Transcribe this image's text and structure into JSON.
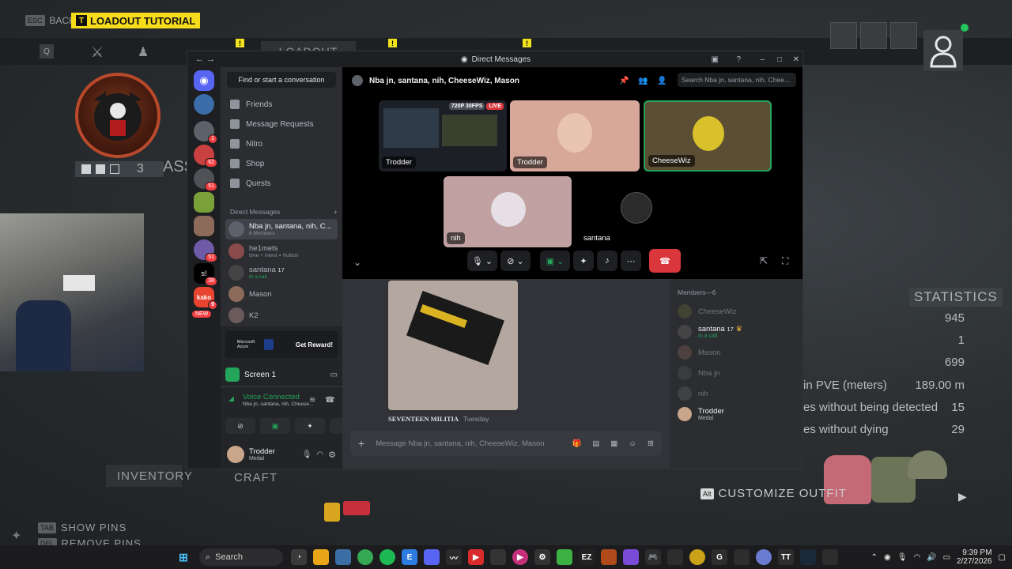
{
  "game": {
    "back_label": "BACK",
    "back_key": "ESC",
    "tutorial_label": "LOADOUT TUTORIAL",
    "tutorial_key": "T",
    "search_key": "Q",
    "active_tab": "LOADOUT",
    "emblem_label": "ASS",
    "emblem_count": "3",
    "statistics_label": "STATISTICS",
    "stats": [
      {
        "label": "",
        "value": "945"
      },
      {
        "label": "",
        "value": "1"
      },
      {
        "label": "",
        "value": "699"
      },
      {
        "label": "in PVE (meters)",
        "value": "189.00 m"
      },
      {
        "label": "es without being detected",
        "value": "15"
      },
      {
        "label": "es without dying",
        "value": "29"
      }
    ],
    "inventory_label": "INVENTORY",
    "craft_label": "CRAFT",
    "customize_label": "CUSTOMIZE OUTFIT",
    "customize_key": "Alt",
    "show_pins": "SHOW PINS",
    "remove_pins": "REMOVE PINS"
  },
  "discord": {
    "window_title": "Direct Messages",
    "find_label": "Find or start a conversation",
    "nav": [
      "Friends",
      "Message Requests",
      "Nitro",
      "Shop",
      "Quests"
    ],
    "dm_header": "Direct Messages",
    "dms": [
      {
        "name": "Nba jn, santana, nih, C...",
        "sub": "6 Members",
        "color": "#5d6169"
      },
      {
        "name": "he1mets",
        "sub": "time + intent = fruition",
        "color": "#8a4b4b"
      },
      {
        "name": "santana",
        "sub": "In a call",
        "badge": "17",
        "color": "#444"
      },
      {
        "name": "Mason",
        "sub": "",
        "color": "#8c6b5a"
      },
      {
        "name": "K2",
        "sub": "",
        "color": "#6b5a5a"
      }
    ],
    "server_badges": [
      "1",
      "62",
      "51",
      "51",
      "38",
      "9",
      "NEW"
    ],
    "promo_cta": "Get Reward!",
    "promo_brand": "Microsoft Azure",
    "screen_label": "Screen 1",
    "voice_status": "Voice Connected",
    "voice_channel": "Nba jn, santana, nih, Cheese...",
    "user_name": "Trodder",
    "user_status": "Medal",
    "group_title": "Nba jn, santana, nih, CheeseWiz, Mason",
    "header_search_placeholder": "Search Nba jn, santana, nih, Chee...",
    "stream_badge_quality": "720P 30FPS",
    "stream_badge_live": "LIVE",
    "tiles": [
      "Trodder",
      "Trodder",
      "CheeseWiz",
      "nih",
      "santana"
    ],
    "message_author": "SEVENTEEN MILITIA",
    "message_time": "Tuesday",
    "message_placeholder": "Message Nba jn, santana, nih, CheeseWiz, Mason",
    "members_header": "Members—6",
    "members": [
      {
        "name": "CheeseWiz",
        "sub": "",
        "dim": true,
        "color": "#6b6a3a"
      },
      {
        "name": "santana",
        "sub": "In a call",
        "badge": "17",
        "dim": false,
        "color": "#444"
      },
      {
        "name": "Mason",
        "sub": "",
        "dim": true,
        "color": "#8c6b5a"
      },
      {
        "name": "Nba jn",
        "sub": "",
        "dim": true,
        "color": "#555"
      },
      {
        "name": "nih",
        "sub": "",
        "dim": true,
        "color": "#666"
      },
      {
        "name": "Trodder",
        "sub": "Medal",
        "dim": false,
        "color": "#c9a58a"
      }
    ]
  },
  "taskbar": {
    "search_label": "Search",
    "time": "9:39 PM",
    "date": "2/27/2026"
  },
  "colors": {
    "accent_yellow": "#f7dc1c",
    "discord_green": "#23a55a",
    "hangup_red": "#da373c",
    "discord_blurple": "#5865f2"
  }
}
